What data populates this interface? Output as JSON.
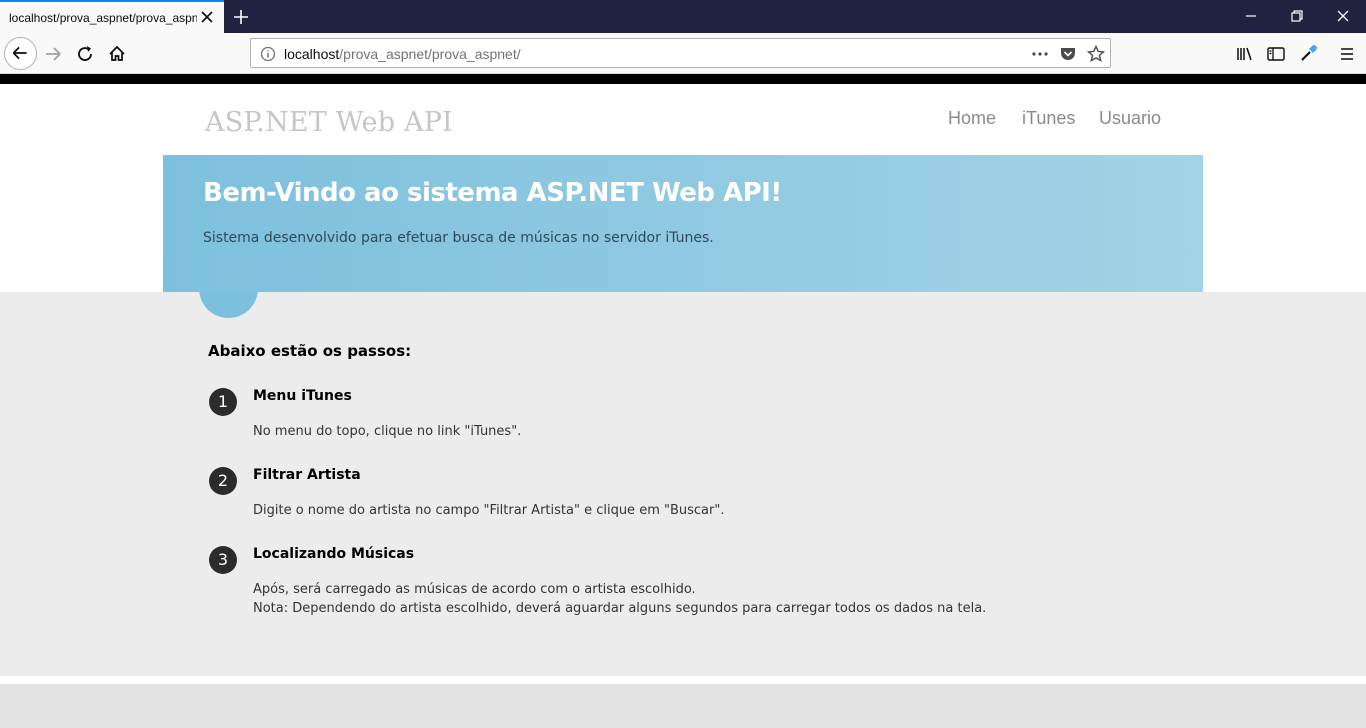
{
  "browser": {
    "tab_title": "localhost/prova_aspnet/prova_aspnet/",
    "url_host": "localhost",
    "url_path": "/prova_aspnet/prova_aspnet/",
    "icons": [
      "back-icon",
      "forward-icon",
      "reload-icon",
      "home-icon",
      "info-icon",
      "more-icon",
      "pocket-icon",
      "bookmark-star-icon",
      "library-icon",
      "sidebar-icon",
      "eyedropper-icon",
      "menu-icon",
      "minimize-icon",
      "restore-icon",
      "close-icon",
      "new-tab-icon"
    ],
    "colors": {
      "titlebar": "#202340",
      "accent": "#0a84ff"
    }
  },
  "site": {
    "brand": "ASP.NET Web API",
    "nav": [
      "Home",
      "iTunes",
      "Usuario"
    ]
  },
  "hero": {
    "title": "Bem-Vindo ao sistema ASP.NET Web API!",
    "subtitle": "Sistema desenvolvido para efetuar busca de músicas no servidor iTunes.",
    "color": "#7dc0dd"
  },
  "steps": {
    "title": "Abaixo estão os passos:",
    "items": [
      {
        "number": "1",
        "heading": "Menu iTunes",
        "lines": [
          "No menu do topo, clique no link \"iTunes\"."
        ]
      },
      {
        "number": "2",
        "heading": "Filtrar Artista",
        "lines": [
          "Digite o nome do artista no campo \"Filtrar Artista\" e clique em \"Buscar\"."
        ]
      },
      {
        "number": "3",
        "heading": "Localizando Músicas",
        "lines": [
          "Após, será carregado as músicas de acordo com o artista escolhido.",
          "Nota: Dependendo do artista escolhido, deverá aguardar alguns segundos para carregar todos os dados na tela."
        ]
      }
    ]
  }
}
